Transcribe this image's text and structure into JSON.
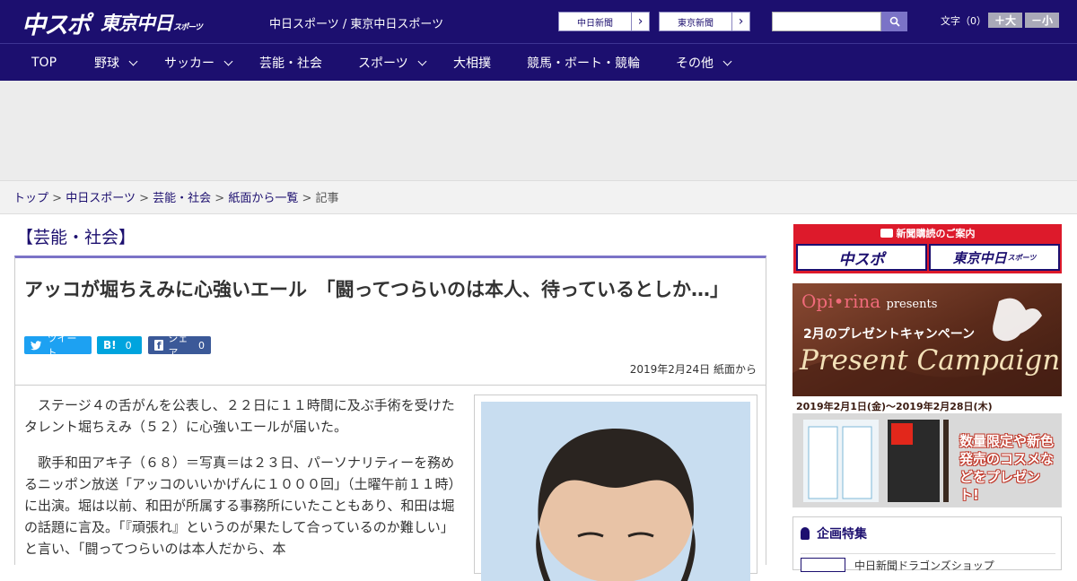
{
  "header": {
    "logo_chunichi_sports": "中スポ",
    "logo_tokyo_chunichi": "東京中日",
    "logo_tokyo_suffix": "スポーツ",
    "site_title": "中日スポーツ / 東京中日スポーツ",
    "paper_links": [
      "中日新聞",
      "東京新聞"
    ],
    "search_placeholder": "",
    "font_size_label": "文字（0）",
    "font_larger": "＋大",
    "font_smaller": "－小"
  },
  "nav": {
    "items": [
      {
        "label": "TOP",
        "has_menu": false
      },
      {
        "label": "野球",
        "has_menu": true
      },
      {
        "label": "サッカー",
        "has_menu": true
      },
      {
        "label": "芸能・社会",
        "has_menu": false
      },
      {
        "label": "スポーツ",
        "has_menu": true
      },
      {
        "label": "大相撲",
        "has_menu": false
      },
      {
        "label": "競馬・ボート・競輪",
        "has_menu": false
      },
      {
        "label": "その他",
        "has_menu": true
      }
    ]
  },
  "breadcrumb": {
    "items": [
      "トップ",
      "中日スポーツ",
      "芸能・社会",
      "紙面から一覧"
    ],
    "current": "記事",
    "separator": ">"
  },
  "article": {
    "category": "【芸能・社会】",
    "headline": "アッコが堀ちえみに心強いエール　「闘ってつらいのは本人、待っているとしか…」",
    "share": {
      "tweet_label": "ツイート",
      "hatena_label": "B!",
      "hatena_count": "0",
      "facebook_label": "シェア",
      "facebook_count": "0"
    },
    "date": "2019年2月24日 紙面から",
    "paragraphs": [
      "ステージ４の舌がんを公表し、２２日に１１時間に及ぶ手術を受けたタレント堀ちえみ（５２）に心強いエールが届いた。",
      "歌手和田アキ子（６８）＝写真＝は２３日、パーソナリティーを務めるニッポン放送「アッコのいいかげんに１０００回」（土曜午前１１時）に出演。堀は以前、和田が所属する事務所にいたこともあり、和田は堀の話題に言及。「『頑張れ』というのが果たして合っているのか難しい」と言い、「闘ってつらいのは本人だから、本"
    ]
  },
  "sidebar": {
    "subscribe_heading": "新聞購読のご案内",
    "subscribe_chunichi": "中スポ",
    "subscribe_tokyo": "東京中日",
    "subscribe_tokyo_suffix": "スポーツ",
    "banner_brand": "Opi•rina",
    "banner_presents": "presents",
    "banner_campaign_title": "2月のプレゼントキャンペーン",
    "banner_big": "Present Campaign",
    "banner_dates": "2019年2月1日(金)〜2019年2月28日(木)",
    "banner_offer": "数量限定や新色発売のコスメなどをプレゼント!",
    "feature_heading": "企画特集",
    "feature_item": "中日新聞ドラゴンズショップ"
  },
  "colors": {
    "navy": "#1c0f6f",
    "accent_lavender": "#7b73c7",
    "subscribe_red": "#dd1a2b",
    "twitter": "#1da1f2",
    "hatena": "#00a4de",
    "facebook": "#3b5998"
  }
}
